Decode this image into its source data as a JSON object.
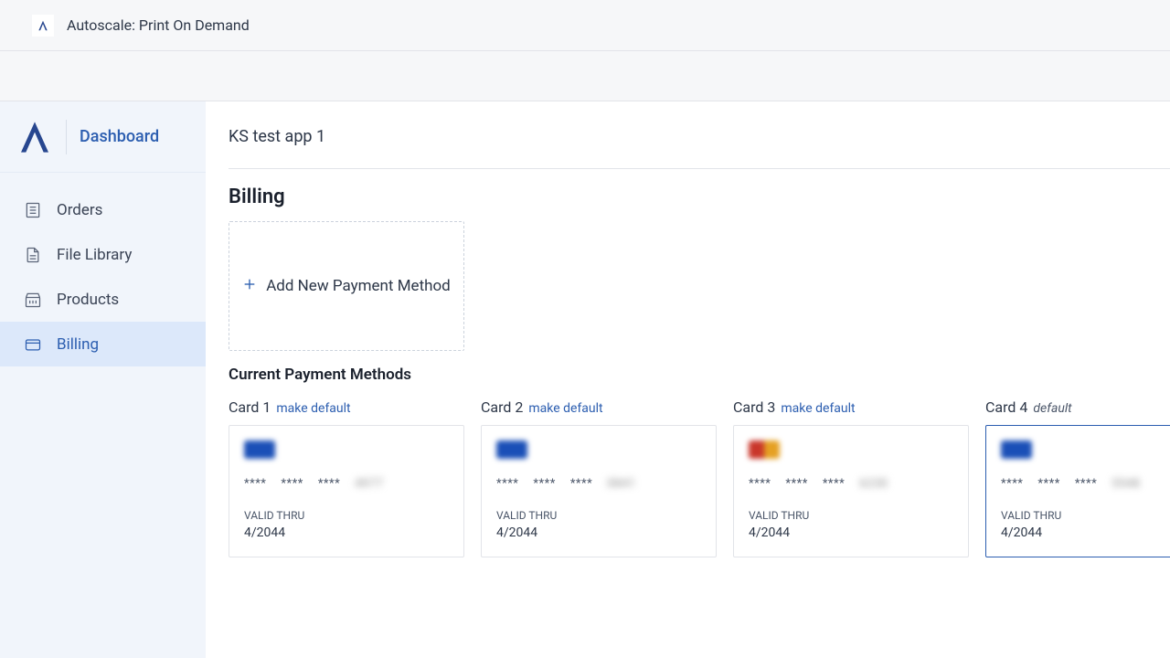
{
  "topbar": {
    "title": "Autoscale: Print On Demand"
  },
  "sidebar": {
    "dashboard_label": "Dashboard",
    "items": [
      {
        "label": "Orders"
      },
      {
        "label": "File Library"
      },
      {
        "label": "Products"
      },
      {
        "label": "Billing"
      }
    ]
  },
  "content": {
    "app_name": "KS test app 1",
    "billing_title": "Billing",
    "add_payment_label": "Add New Payment Method",
    "current_methods_title": "Current Payment Methods",
    "make_default_label": "make default",
    "default_label": "default",
    "valid_thru_label": "VALID THRU",
    "mask": "****",
    "cards": [
      {
        "name": "Card 1",
        "brand": "visa",
        "last4": "4977",
        "expiry": "4/2044",
        "is_default": false
      },
      {
        "name": "Card 2",
        "brand": "visa",
        "last4": "0841",
        "expiry": "4/2044",
        "is_default": false
      },
      {
        "name": "Card 3",
        "brand": "mc",
        "last4": "6230",
        "expiry": "4/2044",
        "is_default": false
      },
      {
        "name": "Card 4",
        "brand": "visa",
        "last4": "5548",
        "expiry": "4/2044",
        "is_default": true
      }
    ]
  }
}
